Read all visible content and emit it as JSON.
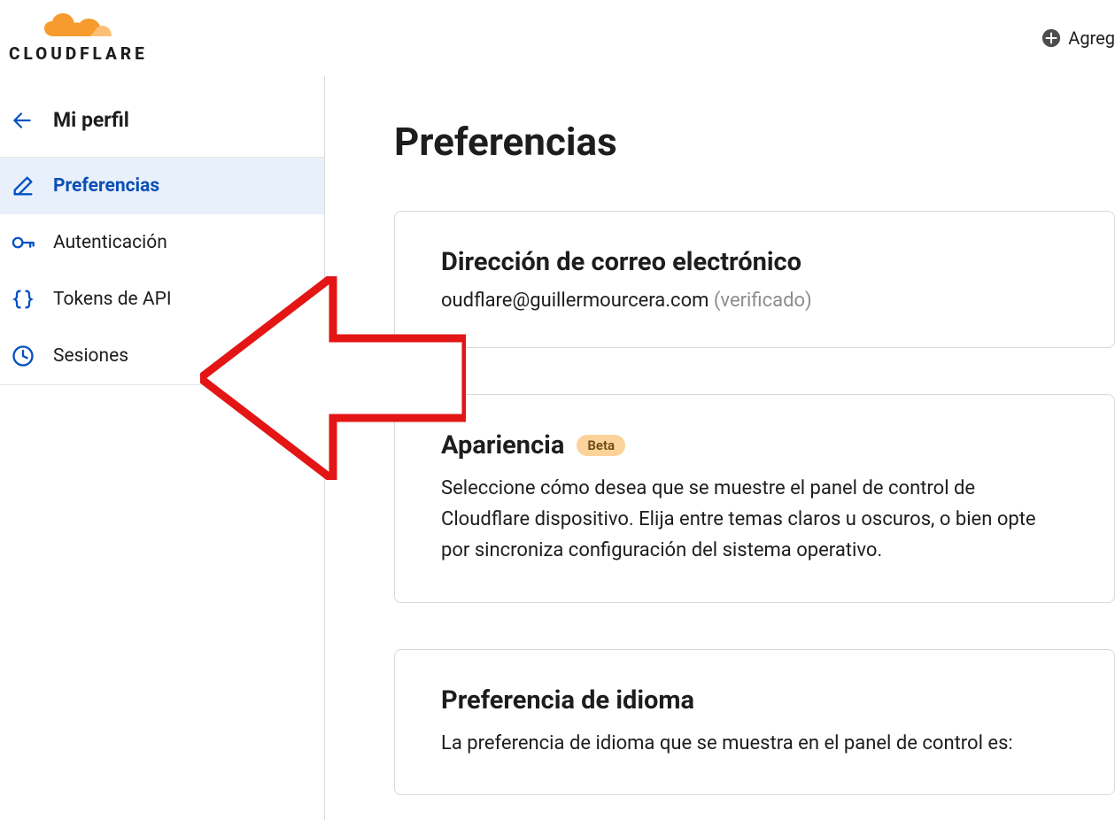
{
  "header": {
    "brand": "CLOUDFLARE",
    "action_label": "Agreg"
  },
  "sidebar": {
    "back_label": "Mi perfil",
    "items": [
      {
        "label": "Preferencias",
        "icon": "pencil-icon",
        "active": true
      },
      {
        "label": "Autenticación",
        "icon": "key-icon",
        "active": false
      },
      {
        "label": "Tokens de API",
        "icon": "braces-icon",
        "active": false
      },
      {
        "label": "Sesiones",
        "icon": "clock-icon",
        "active": false
      }
    ]
  },
  "main": {
    "title": "Preferencias",
    "email_card": {
      "title": "Dirección de correo electrónico",
      "email": "oudflare@guillermourcera.com",
      "verified_label": "(verificado)"
    },
    "appearance_card": {
      "title": "Apariencia",
      "badge": "Beta",
      "description": "Seleccione cómo desea que se muestre el panel de control de Cloudflare dispositivo. Elija entre temas claros u oscuros, o bien opte por sincroniza configuración del sistema operativo."
    },
    "language_card": {
      "title": "Preferencia de idioma",
      "description": "La preferencia de idioma que se muestra en el panel de control es:"
    }
  }
}
